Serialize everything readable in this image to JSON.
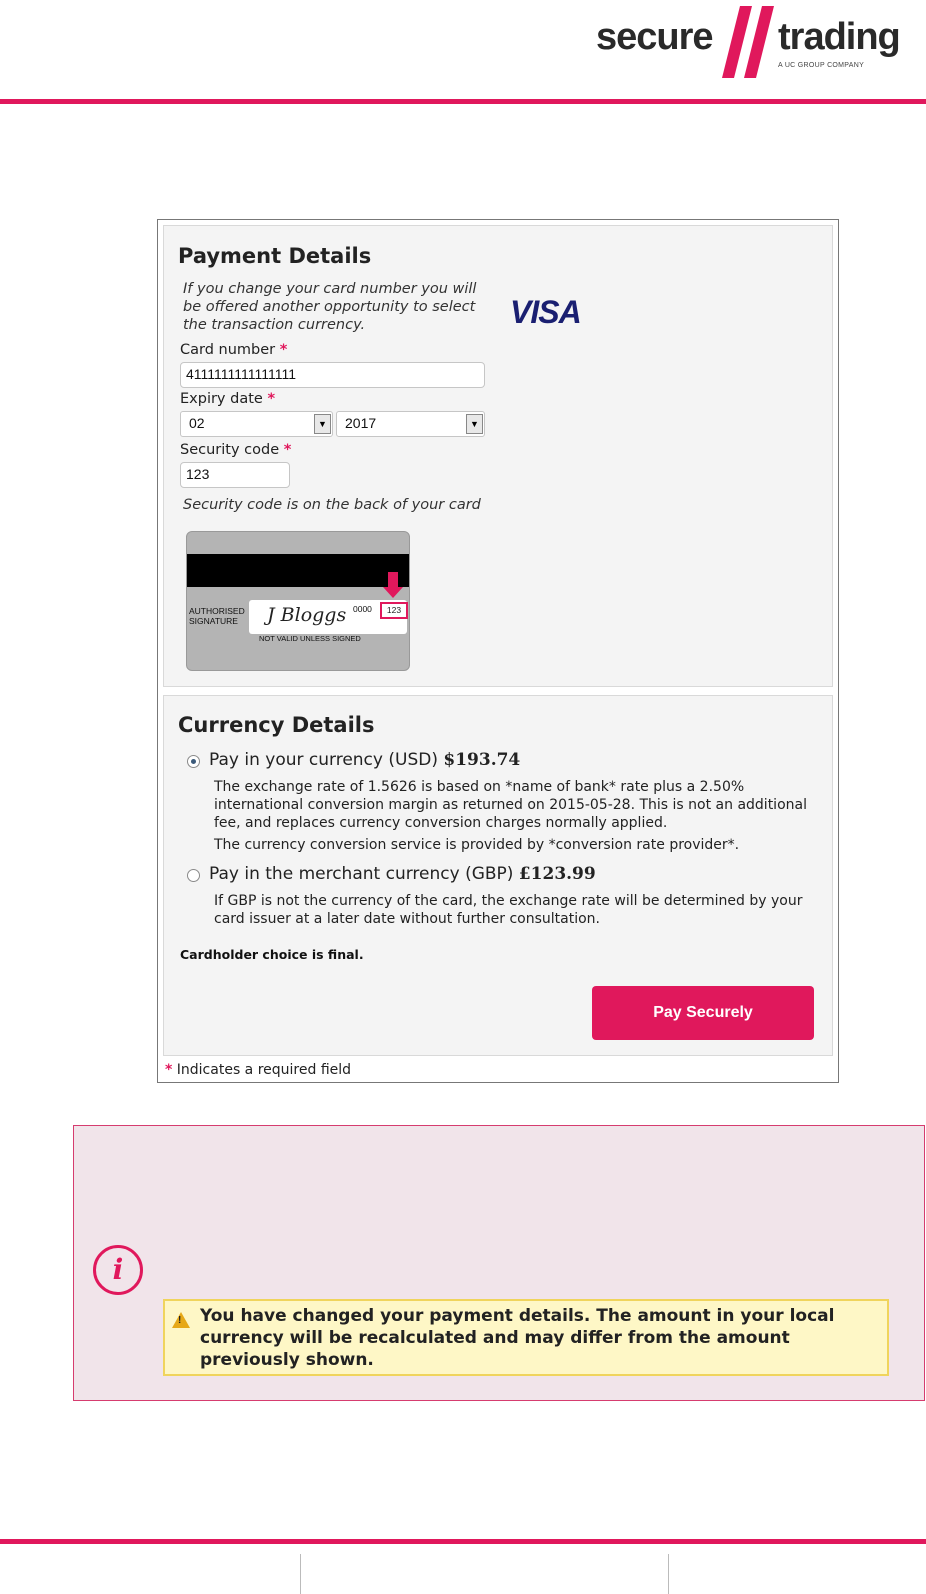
{
  "brand": {
    "name_left": "secure",
    "name_right": "trading",
    "tagline": "A UC GROUP COMPANY",
    "accent": "#e0185c"
  },
  "payment": {
    "title": "Payment Details",
    "note": "If you change your card number you will be offered another opportunity to select the transaction currency.",
    "card_brand": "VISA",
    "card_number_label": "Card number",
    "card_number_value": "4111111111111111",
    "expiry_label": "Expiry date",
    "expiry_month": "02",
    "expiry_year": "2017",
    "security_label": "Security code",
    "security_value": "123",
    "security_hint": "Security code is on the back of your card",
    "required_mark": "*",
    "card_image": {
      "authorised": "AUTHORISED",
      "signature": "SIGNATURE",
      "signature_name": "J Bloggs",
      "digits": "0000",
      "cvv": "123",
      "not_valid": "NOT VALID UNLESS SIGNED"
    }
  },
  "currency": {
    "title": "Currency Details",
    "option1": {
      "label": "Pay in your currency (USD)",
      "amount": "$193.74",
      "selected": true,
      "desc1": "The exchange rate of 1.5626 is based on *name of bank* rate plus a 2.50% international conversion margin as returned on 2015-05-28. This is not an additional fee, and replaces currency conversion charges normally applied.",
      "desc2": "The currency conversion service is provided by *conversion rate provider*."
    },
    "option2": {
      "label": "Pay in the merchant currency (GBP)",
      "amount": "£123.99",
      "selected": false,
      "desc": "If GBP is not the currency of the card, the exchange rate will be determined by your card issuer at a later date without further consultation."
    },
    "final_note": "Cardholder choice is final.",
    "pay_button": "Pay Securely"
  },
  "required_note": {
    "mark": "*",
    "text": "Indicates a required field"
  },
  "info": {
    "icon": "info-icon",
    "warning_icon": "warning-icon",
    "message": "You have changed your payment details. The amount in your local currency will be recalculated and may differ from the amount previously shown."
  }
}
